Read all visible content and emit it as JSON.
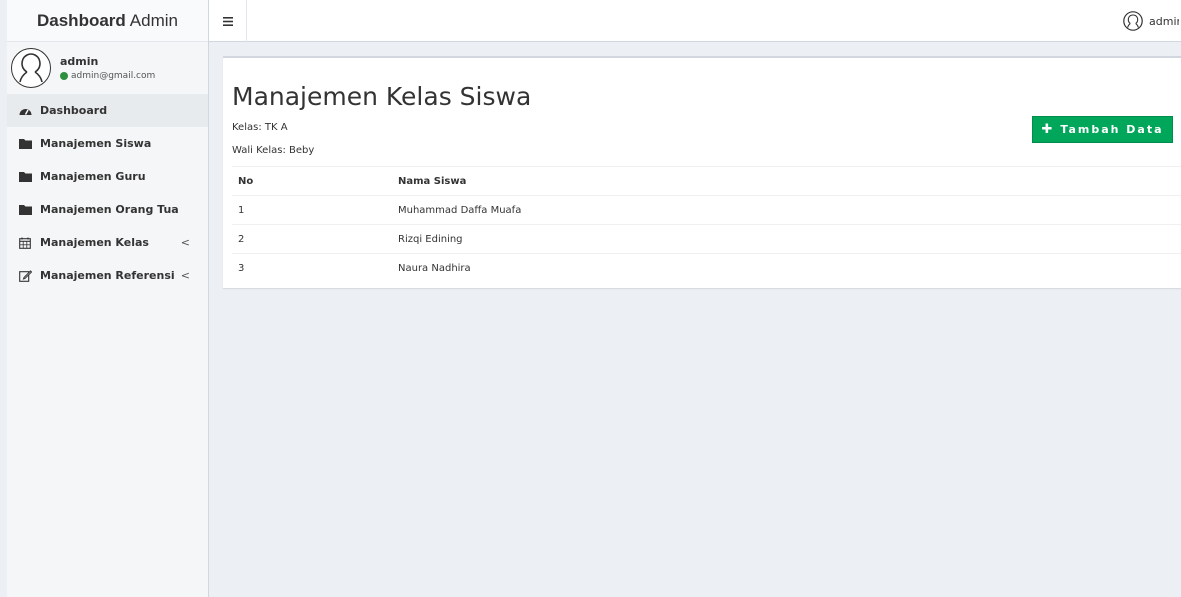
{
  "brand": {
    "bold": "Dashboard",
    "light": "Admin"
  },
  "user": {
    "name": "admin",
    "email": "admin@gmail.com",
    "status_color": "#2f8f3f"
  },
  "sidebar": {
    "items": [
      {
        "label": "Dashboard",
        "icon": "dashboard-icon",
        "active": true
      },
      {
        "label": "Manajemen Siswa",
        "icon": "folder-icon"
      },
      {
        "label": "Manajemen Guru",
        "icon": "folder-icon"
      },
      {
        "label": "Manajemen Orang Tua",
        "icon": "folder-icon"
      },
      {
        "label": "Manajemen Kelas",
        "icon": "calendar-icon",
        "chevron": "<"
      },
      {
        "label": "Manajemen Referensi",
        "icon": "edit-icon",
        "chevron": "<"
      }
    ]
  },
  "navbar": {
    "toggle_icon": "menu-icon",
    "user_name": "admin"
  },
  "main": {
    "title": "Manajemen Kelas Siswa",
    "kelas": "Kelas: TK A",
    "wali_kelas": "Wali Kelas: Beby",
    "add_button": "Tambah Data",
    "accent_color": "#00a65a",
    "table": {
      "headers": [
        "No",
        "Nama Siswa"
      ],
      "rows": [
        [
          "1",
          "Muhammad Daffa Muafa"
        ],
        [
          "2",
          "Rizqi Edining"
        ],
        [
          "3",
          "Naura Nadhira"
        ]
      ]
    }
  }
}
